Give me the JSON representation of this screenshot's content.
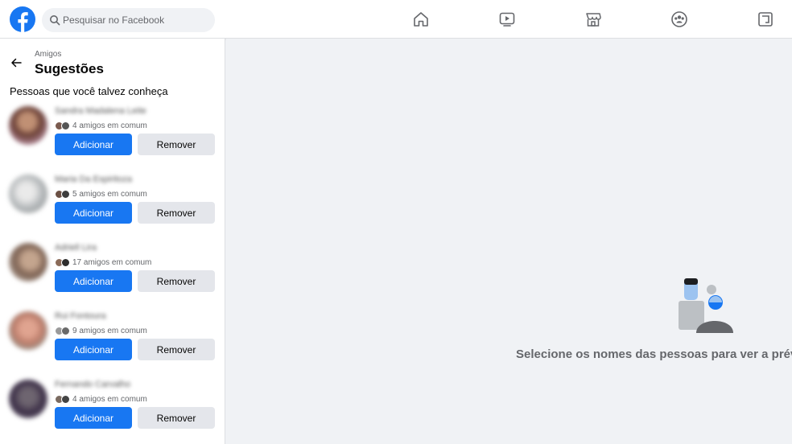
{
  "header": {
    "search_placeholder": "Pesquisar no Facebook",
    "nav": [
      {
        "name": "home",
        "icon": "home-icon"
      },
      {
        "name": "watch",
        "icon": "video-icon"
      },
      {
        "name": "marketplace",
        "icon": "store-icon"
      },
      {
        "name": "groups",
        "icon": "groups-icon"
      },
      {
        "name": "gaming",
        "icon": "gaming-icon"
      }
    ]
  },
  "sidebar": {
    "breadcrumb": "Amigos",
    "title": "Sugestões",
    "section_title": "Pessoas que você talvez conheça",
    "suggestions": [
      {
        "name": "Sandra Madalena Leite",
        "mutual": "4 amigos em comum",
        "add_label": "Adicionar",
        "remove_label": "Remover"
      },
      {
        "name": "Maria Da Espiritoza",
        "mutual": "5 amigos em comum",
        "add_label": "Adicionar",
        "remove_label": "Remover"
      },
      {
        "name": "Adriell Lira",
        "mutual": "17 amigos em comum",
        "add_label": "Adicionar",
        "remove_label": "Remover"
      },
      {
        "name": "Rui Fontoura",
        "mutual": "9 amigos em comum",
        "add_label": "Adicionar",
        "remove_label": "Remover"
      },
      {
        "name": "Fernando Carvalho",
        "mutual": "4 amigos em comum",
        "add_label": "Adicionar",
        "remove_label": "Remover"
      }
    ]
  },
  "main": {
    "empty_text": "Selecione os nomes das pessoas para ver a prév"
  },
  "colors": {
    "brand": "#1877f2",
    "secondary_button": "#e4e6eb",
    "background": "#f0f2f5"
  }
}
